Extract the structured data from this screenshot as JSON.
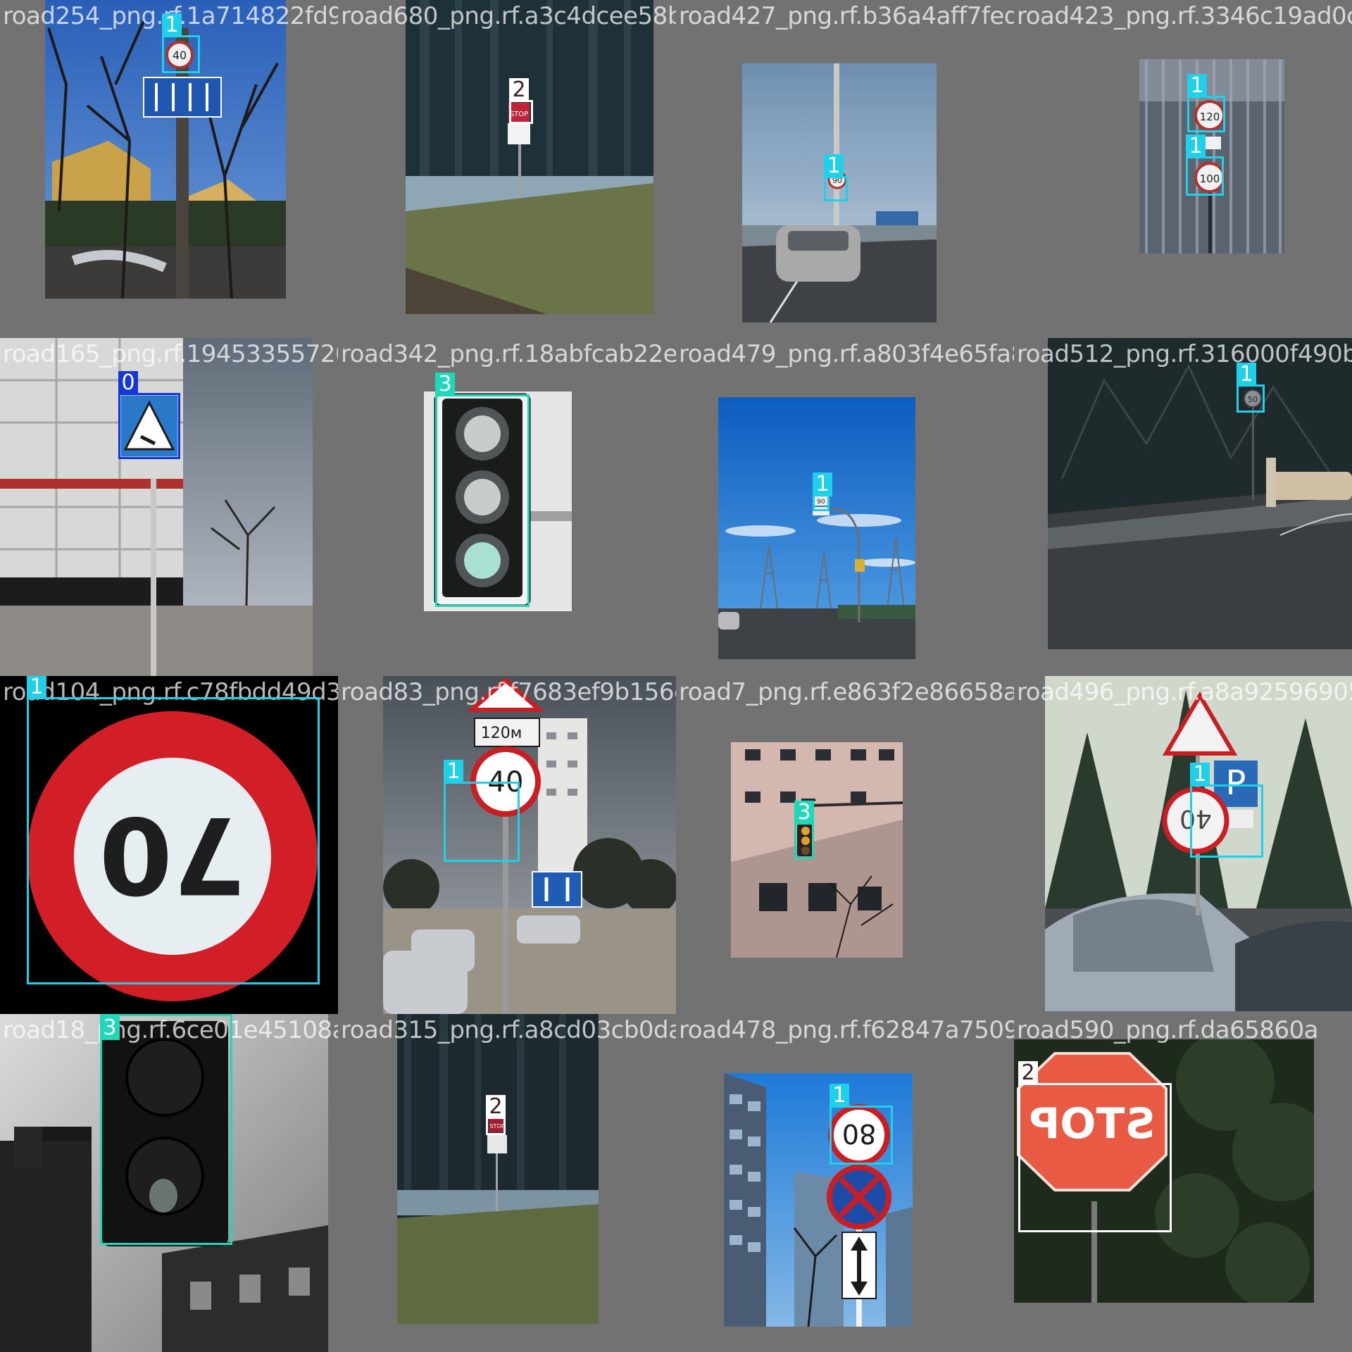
{
  "title": "",
  "classes": {
    "0": {
      "color": "#1536d8"
    },
    "1": {
      "color": "#20d0e8"
    },
    "2": {
      "color": "#ffffff",
      "text_color": "#3a2020"
    },
    "3": {
      "color": "#1ed8b8"
    }
  },
  "tiles": [
    {
      "filename": "road254_png.rf.1a714822fd97d1680ac",
      "boxes": [
        {
          "cls": "1"
        }
      ]
    },
    {
      "filename": "road680_png.rf.a3c4dcee58b62842",
      "boxes": [
        {
          "cls": "2"
        }
      ]
    },
    {
      "filename": "road427_png.rf.b36a4aff7fed73487",
      "boxes": [
        {
          "cls": "1"
        }
      ]
    },
    {
      "filename": "road423_png.rf.3346c19ad0c4",
      "boxes": [
        {
          "cls": "1"
        },
        {
          "cls": "1"
        }
      ]
    },
    {
      "filename": "road165_png.rf.19453355720fdcb42",
      "boxes": [
        {
          "cls": "0"
        }
      ]
    },
    {
      "filename": "road342_png.rf.18abfcab22e7031f07",
      "boxes": [
        {
          "cls": "3"
        }
      ]
    },
    {
      "filename": "road479_png.rf.a803f4e65fa8f351f52",
      "boxes": [
        {
          "cls": "1"
        }
      ]
    },
    {
      "filename": "road512_png.rf.316000f490b",
      "boxes": [
        {
          "cls": "1"
        }
      ]
    },
    {
      "filename": "road104_png.rf.c78fbdd49d30ea1883",
      "boxes": [
        {
          "cls": "1"
        }
      ]
    },
    {
      "filename": "road83_png.rf.f7683ef9b156e4a7f9",
      "boxes": [
        {
          "cls": "1"
        }
      ]
    },
    {
      "filename": "road7_png.rf.e863f2e86658a9a14960",
      "boxes": [
        {
          "cls": "3"
        }
      ]
    },
    {
      "filename": "road496_png.rf.a8a92596905",
      "boxes": [
        {
          "cls": "1"
        }
      ]
    },
    {
      "filename": "road18_png.rf.6ce01e45108ae6133158",
      "boxes": [
        {
          "cls": "3"
        }
      ]
    },
    {
      "filename": "road315_png.rf.a8cd03cb0da47986",
      "boxes": [
        {
          "cls": "2"
        }
      ]
    },
    {
      "filename": "road478_png.rf.f62847a75090d59023",
      "boxes": [
        {
          "cls": "1"
        }
      ]
    },
    {
      "filename": "road590_png.rf.da65860a",
      "boxes": [
        {
          "cls": "2"
        }
      ]
    }
  ],
  "sign_text": {
    "speed_40": "40",
    "speed_90": "90",
    "speed_120": "120",
    "speed_100": "100",
    "speed_70": "70",
    "distance": "120м",
    "speed_50": "50",
    "speed_80": "80",
    "stop": "STOP"
  }
}
